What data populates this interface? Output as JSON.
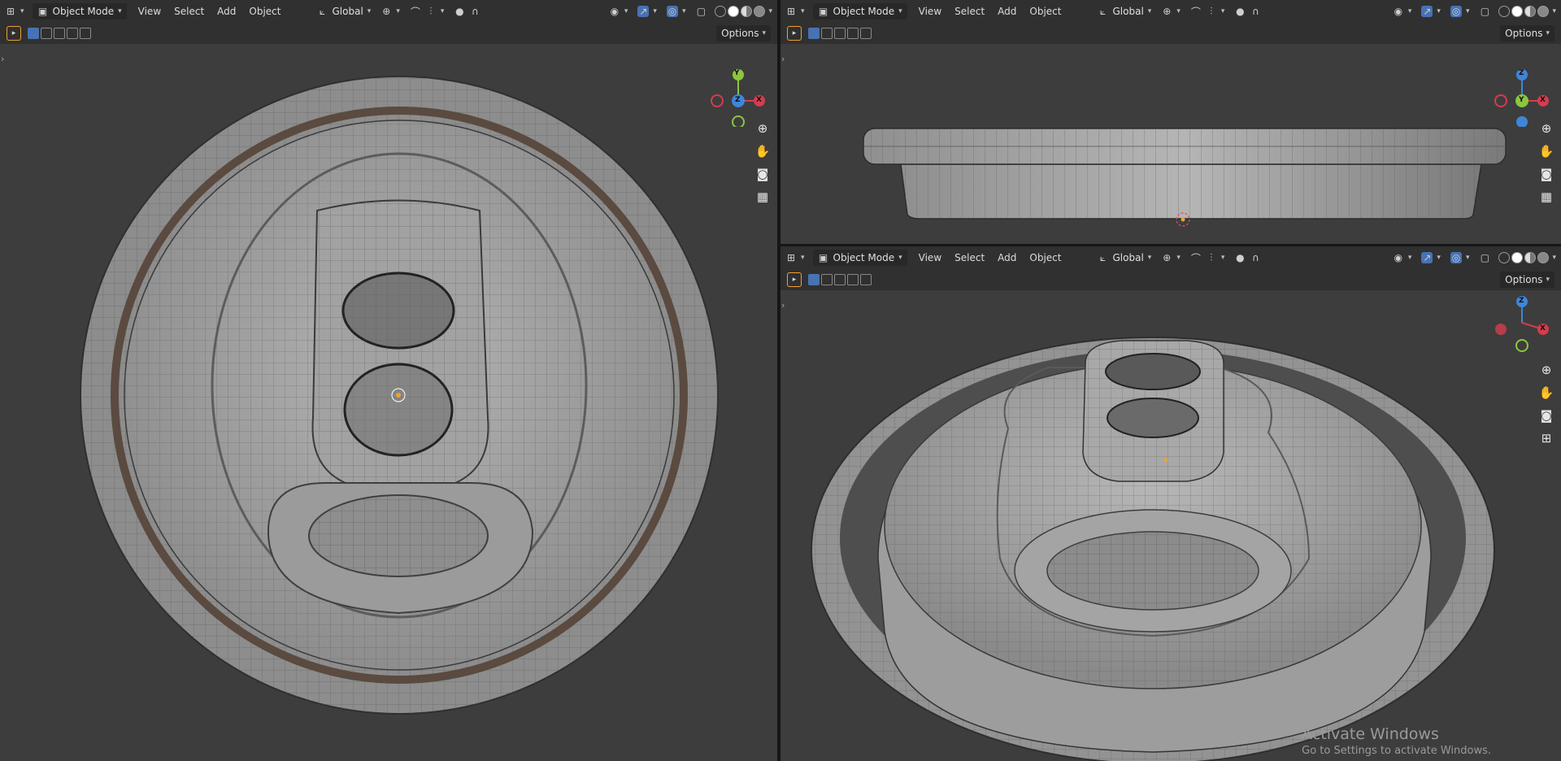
{
  "header": {
    "mode_label": "Object Mode",
    "menu": [
      "View",
      "Select",
      "Add",
      "Object"
    ],
    "orientation_label": "Global",
    "options_label": "Options"
  },
  "viewports": [
    {
      "name": "top-view",
      "gizmo": {
        "center_axis": "Z",
        "up_axis": "Y",
        "right_axis": "X"
      }
    },
    {
      "name": "front-view",
      "gizmo": {
        "center_axis": "Y",
        "up_axis": "Z",
        "right_axis": "X"
      }
    },
    {
      "name": "perspective-view",
      "gizmo": {
        "center_axis": "",
        "up_axis": "Z",
        "right_axis": "X"
      }
    }
  ],
  "watermark": {
    "line1": "Activate Windows",
    "line2": "Go to Settings to activate Windows."
  },
  "colors": {
    "x_axis": "#d43d4e",
    "y_axis": "#8cc63e",
    "z_axis": "#3f86d9",
    "viewport_bg": "#3d3d3d",
    "header_bg": "#303030",
    "accent": "#4772b3",
    "mesh": "#a9a9a9",
    "wire": "#3a3a3a"
  },
  "icons": [
    "editor-type-icon",
    "object-mode-icon",
    "transform-orientation-icon",
    "pivot-icon",
    "snap-icon",
    "proportional-edit-icon",
    "visibility-icon",
    "gizmo-icon",
    "overlay-icon",
    "xray-icon",
    "shading-wire-icon",
    "shading-solid-icon",
    "shading-material-icon",
    "shading-rendered-icon",
    "zoom-icon",
    "pan-hand-icon",
    "camera-icon",
    "grid-icon",
    "perspective-icon",
    "select-tool-icon"
  ]
}
